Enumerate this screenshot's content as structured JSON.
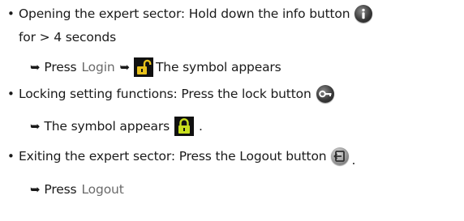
{
  "items": [
    {
      "text_a": "Opening the expert sector: Hold down the info button",
      "icon": "info-icon",
      "text_b": "for > 4 seconds",
      "sub": {
        "arrow": "➥",
        "word1": "Press",
        "action": "Login",
        "icon": "unlocked-padlock-icon",
        "word2": "The symbol appears"
      }
    },
    {
      "text_a": "Locking setting functions: Press the lock button",
      "icon": "key-icon",
      "sub": {
        "arrow": "➥",
        "word1": "The symbol appears",
        "icon": "locked-padlock-icon",
        "tail": "."
      }
    },
    {
      "text_a": "Exiting the expert sector: Press the Logout button",
      "icon": "logout-icon",
      "tail": ".",
      "sub": {
        "arrow": "➥",
        "word1": "Press",
        "action": "Logout"
      }
    }
  ],
  "bullet_char": "•",
  "colors": {
    "text": "#1a1a1a",
    "action_text": "#6a6a6a",
    "badge_bg": "#111111",
    "unlock_yellow": "#e8c21c",
    "lock_green": "#c9df1e",
    "icon_dark": "#2e2e2e"
  }
}
